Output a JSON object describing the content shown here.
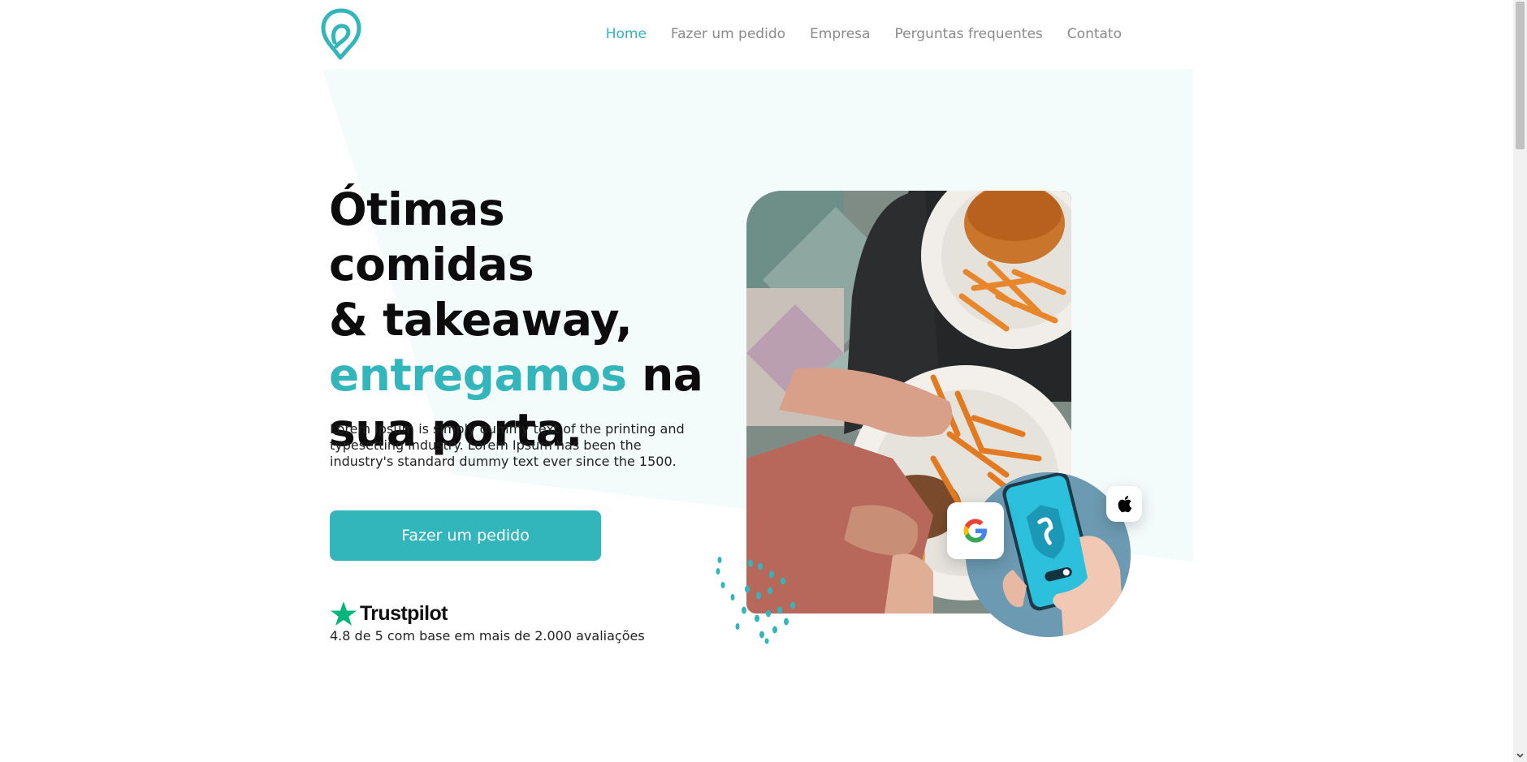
{
  "header": {
    "logo_icon": "location-pin-icon",
    "nav": [
      {
        "label": "Home",
        "active": true
      },
      {
        "label": "Fazer um pedido",
        "active": false
      },
      {
        "label": "Empresa",
        "active": false
      },
      {
        "label": "Perguntas frequentes",
        "active": false
      },
      {
        "label": "Contato",
        "active": false
      }
    ]
  },
  "hero": {
    "headline_line1": "Ótimas comidas",
    "headline_line2": "& takeaway,",
    "headline_accent": "entregamos",
    "headline_line3_rest": " na",
    "headline_line4": "sua porta.",
    "description": "Lorem Ipsum is simply dummy text of the printing and typesetting industry. Lorem Ipsum has been the industry's standard dummy text ever since the 1500.",
    "cta_label": "Fazer um pedido",
    "trust_brand": "Trustpilot",
    "trust_text": "4.8 de 5 com base em mais de 2.000 avaliações"
  },
  "icons": {
    "google": "google-icon",
    "apple": "apple-icon",
    "star": "trustpilot-star-icon"
  },
  "colors": {
    "accent": "#33b5bc",
    "nav_text": "#8a8a8a",
    "hero_bg": "#f4fbfb",
    "trust_green": "#00b67a"
  }
}
